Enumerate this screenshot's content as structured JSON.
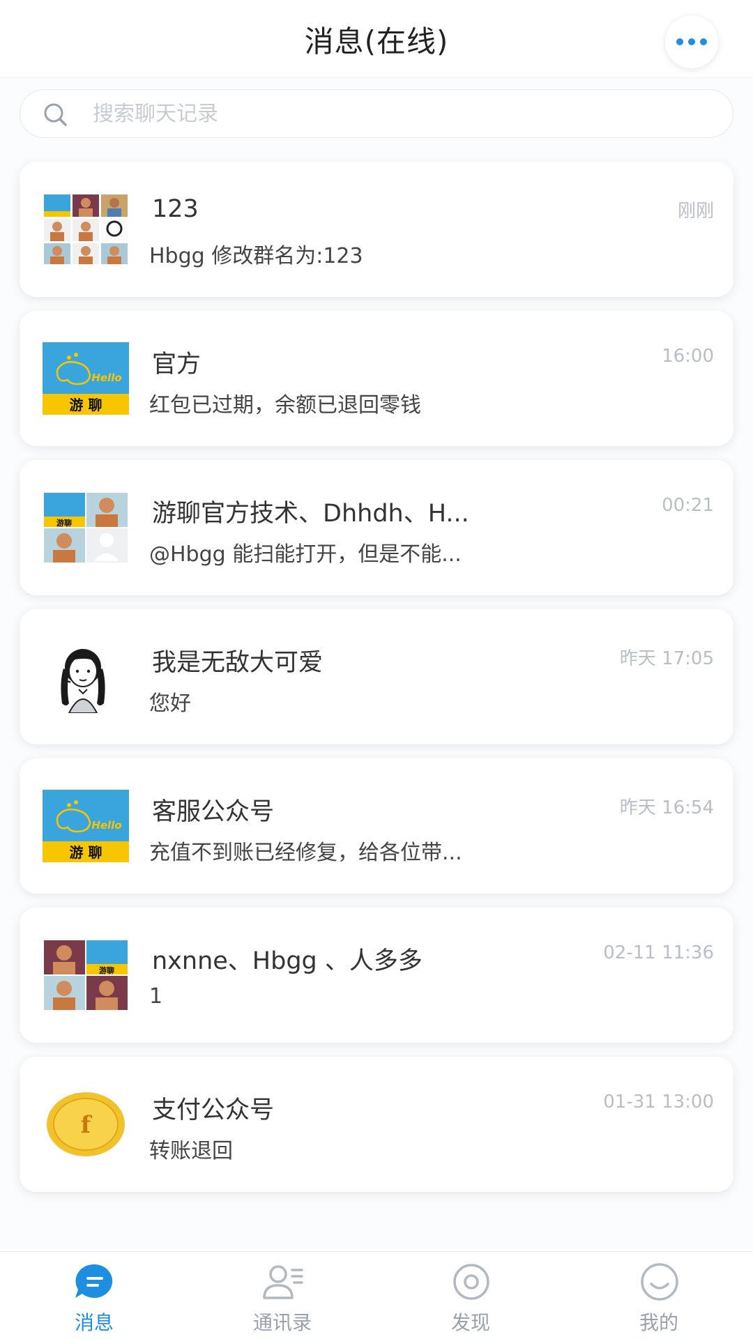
{
  "header": {
    "title": "消息(在线)"
  },
  "search": {
    "placeholder": "搜索聊天记录"
  },
  "conversations": [
    {
      "name": "123",
      "message": "Hbgg  修改群名为:123",
      "time": "刚刚",
      "avatar": "group-3x3-avatar"
    },
    {
      "name": "官方",
      "message": "红包已过期，余额已退回零钱",
      "time": "16:00",
      "avatar": "youliao-logo"
    },
    {
      "name": "游聊官方技术、Dhhdh、H...",
      "message": "@Hbgg   能扫能打开，但是不能...",
      "time": "00:21",
      "avatar": "group-2x2-avatar"
    },
    {
      "name": "我是无敌大可爱",
      "message": "您好",
      "time": "昨天 17:05",
      "avatar": "cartoon-girl"
    },
    {
      "name": "客服公众号",
      "message": "充值不到账已经修复，给各位带...",
      "time": "昨天 16:54",
      "avatar": "youliao-logo"
    },
    {
      "name": "nxnne、Hbgg 、人多多",
      "message": "1",
      "time": "02-11 11:36",
      "avatar": "group-2x2-avatar"
    },
    {
      "name": "支付公众号",
      "message": "转账退回",
      "time": "01-31 13:00",
      "avatar": "gold-coin"
    }
  ],
  "logo_text": {
    "hello": "Hello",
    "brand": "游 聊",
    "brand_small": "游聊",
    "coin": "f"
  },
  "tabs": [
    {
      "label": "消息",
      "icon": "message-icon",
      "active": true
    },
    {
      "label": "通讯录",
      "icon": "contacts-icon",
      "active": false
    },
    {
      "label": "发现",
      "icon": "discover-icon",
      "active": false
    },
    {
      "label": "我的",
      "icon": "profile-icon",
      "active": false
    }
  ],
  "colors": {
    "accent": "#1e8fe0",
    "logo_blue": "#3aa4dd",
    "logo_yellow": "#f7c600"
  }
}
